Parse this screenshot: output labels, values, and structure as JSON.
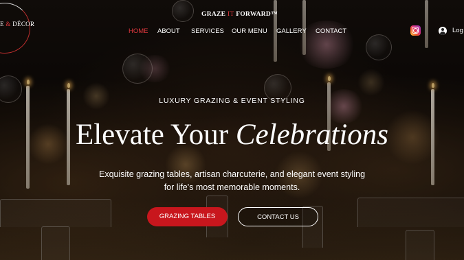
{
  "header": {
    "logo": {
      "text_left": "E",
      "ampersand": "&",
      "text_right": "DÉCOR"
    },
    "brand": {
      "left": "GRAZE",
      "mid": "IT",
      "right": "FORWARD™"
    },
    "nav": [
      {
        "label": "HOME",
        "active": true
      },
      {
        "label": "ABOUT",
        "active": false
      },
      {
        "label": "SERVICES",
        "active": false
      },
      {
        "label": "OUR MENU",
        "active": false
      },
      {
        "label": "GALLERY",
        "active": false
      },
      {
        "label": "CONTACT",
        "active": false
      }
    ],
    "social_icon": "instagram-icon",
    "login_icon": "user-icon",
    "login_label": "Log In"
  },
  "hero": {
    "kicker": "LUXURY GRAZING & EVENT STYLING",
    "headline_plain": "Elevate Your",
    "headline_italic": "Celebrations",
    "subtext_line1": "Exquisite grazing tables, artisan charcuterie, and elegant event styling",
    "subtext_line2": "for life's most memorable moments.",
    "primary_button": "GRAZING TABLES",
    "secondary_button": "CONTACT US"
  },
  "colors": {
    "accent": "#c8161d",
    "active_nav": "#e0383e",
    "text": "#ffffff"
  }
}
